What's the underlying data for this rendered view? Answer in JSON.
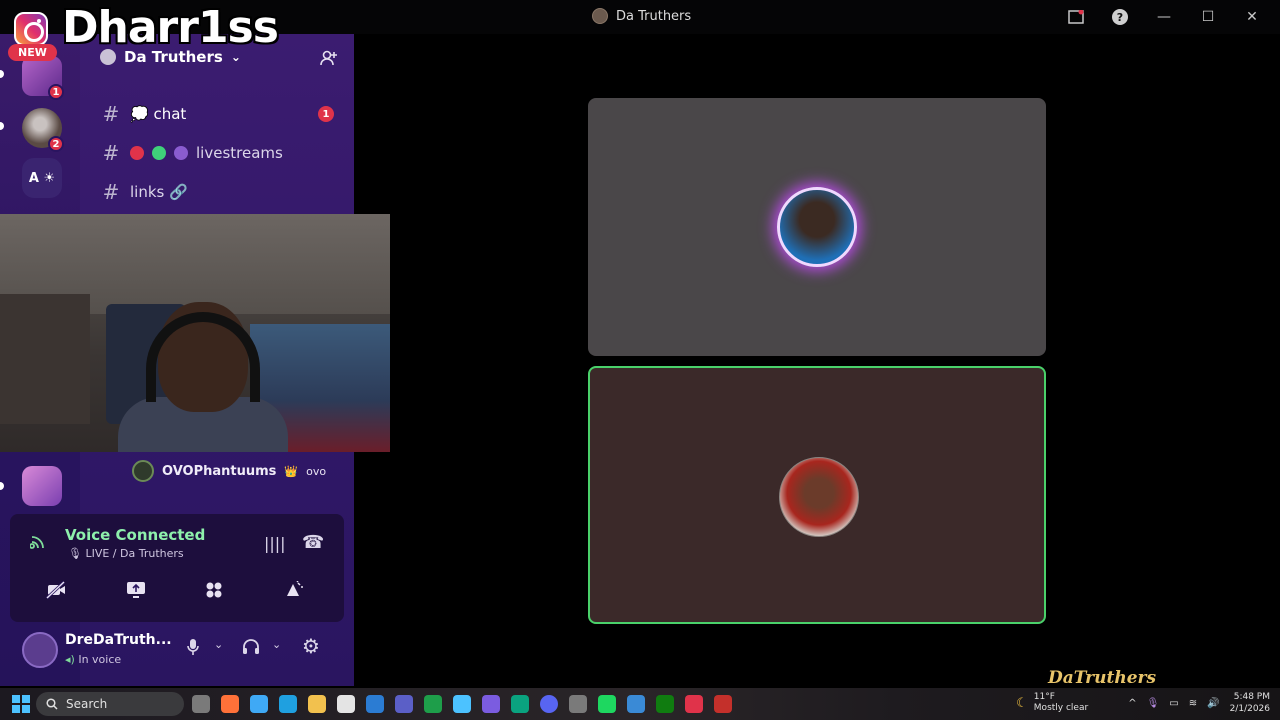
{
  "window": {
    "title": "Da Truthers",
    "help_label": "?",
    "minimize": "—",
    "maximize": "☐",
    "close": "✕"
  },
  "overlay": {
    "brand": "Dharr1ss",
    "new_badge": "NEW",
    "watermark": "DaTruthers"
  },
  "rail": {
    "servers": [
      {
        "badge": "1",
        "color": "#8a3fb8"
      },
      {
        "badge": "2",
        "color": "#5a4a44"
      },
      {
        "label": "A ☀",
        "color": "#3a2470"
      },
      {
        "color": "#b565c9"
      }
    ]
  },
  "server": {
    "name": "Da Truthers",
    "chevron": "⌄",
    "add_member_icon": "⁺👤"
  },
  "channels": [
    {
      "name": "💭 chat",
      "badge": "1"
    },
    {
      "name": "livestreams",
      "dots": [
        "#e0334a",
        "#3fd07a",
        "#8a5cd0"
      ]
    },
    {
      "name": "links 🔗"
    }
  ],
  "voice_member": {
    "name": "OVOPhantuums",
    "tag": "ovo"
  },
  "voice_connection": {
    "title": "Voice Connected",
    "subtitle": "🎙 LIVE / Da Truthers",
    "waveform_icon": "||||",
    "disconnect_icon": "☎"
  },
  "voice_buttons": [
    {
      "name": "camera-off",
      "glyph": "✕"
    },
    {
      "name": "share-screen",
      "glyph": "⇪"
    },
    {
      "name": "activities",
      "glyph": "✦"
    },
    {
      "name": "soundboard",
      "glyph": "✧"
    }
  ],
  "user": {
    "name": "DreDaTruth...",
    "status": "In voice",
    "mic": "🎙",
    "headset": "🎧",
    "settings": "⚙",
    "chevron": "⌄"
  },
  "taskbar": {
    "search_placeholder": "Search",
    "weather_temp": "11°F",
    "weather_desc": "Mostly clear",
    "time": "5:48 PM",
    "date": "2/1/2026",
    "apps": [
      "#7a7a7a",
      "#ff7139",
      "#3fa9f5",
      "#1fa0e0",
      "#f2c14e",
      "#e4e4e4",
      "#2b7cd3",
      "#5b5fc7",
      "#1e9e4a",
      "#4cc2ff",
      "#7b5ce0",
      "#0aa37f",
      "#5865f2",
      "#7a7a7a",
      "#1ed760",
      "#3a8ad6",
      "#107c10",
      "#e0334a",
      "#c4302b"
    ]
  },
  "colors": {
    "speaking_border": "#4ad16a",
    "accent_green": "#8ef0ac",
    "badge_red": "#e0334a",
    "panel_purple": "#34196a"
  }
}
